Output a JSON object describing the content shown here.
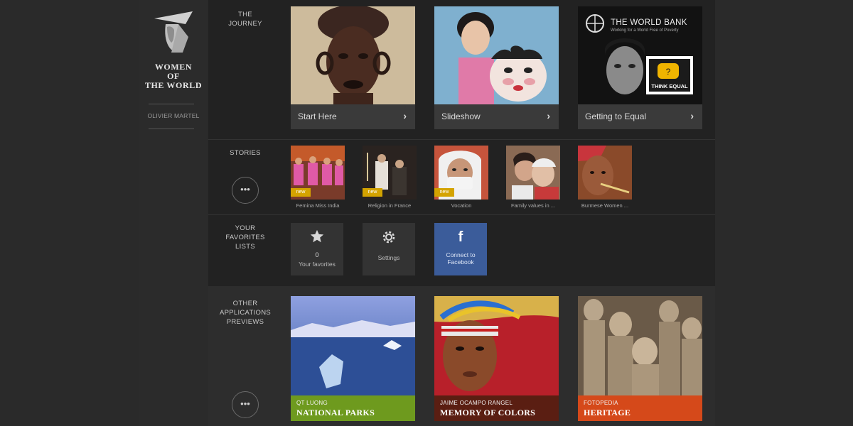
{
  "sidebar": {
    "brand_lines": [
      "WOMEN",
      "OF",
      "THE WORLD"
    ],
    "author": "OLIVIER MARTEL",
    "logo_icon": "woman-in-conical-hat-icon"
  },
  "journey": {
    "label": [
      "THE",
      "JOURNEY"
    ],
    "cards": [
      {
        "title": "Start Here"
      },
      {
        "title": "Slideshow"
      },
      {
        "title": "Getting to Equal",
        "worldbank_title": "THE WORLD BANK",
        "worldbank_sub": "Working for a World Free of Poverty",
        "think_equal": "THINK EQUAL"
      }
    ]
  },
  "stories": {
    "label": "STORIES",
    "more": "•••",
    "items": [
      {
        "caption": "Femina Miss India",
        "badge": "new"
      },
      {
        "caption": "Religion in France",
        "badge": "new"
      },
      {
        "caption": "Vocation",
        "badge": "new"
      },
      {
        "caption": "Family values in ...",
        "badge": ""
      },
      {
        "caption": "Burmese Women ...",
        "badge": ""
      }
    ]
  },
  "favorites": {
    "label": [
      "YOUR",
      "FAVORITES",
      "LISTS"
    ],
    "tiles": [
      {
        "count": "0",
        "label": "Your favorites",
        "icon": "star-icon"
      },
      {
        "label": "Settings",
        "icon": "gear-icon"
      },
      {
        "label_lines": [
          "Connect to",
          "Facebook"
        ],
        "icon": "facebook-icon"
      }
    ]
  },
  "other": {
    "label": [
      "OTHER",
      "APPLICATIONS",
      "PREVIEWS"
    ],
    "more": "•••",
    "apps": [
      {
        "author": "QT LUONG",
        "title": "NATIONAL PARKS",
        "color": "#6e9a1e"
      },
      {
        "author": "JAIME OCAMPO RANGEL",
        "title": "MEMORY OF COLORS",
        "color": "#5a1e12"
      },
      {
        "author": "FOTOPEDIA",
        "title": "HERITAGE",
        "color": "#d5491a"
      }
    ]
  }
}
